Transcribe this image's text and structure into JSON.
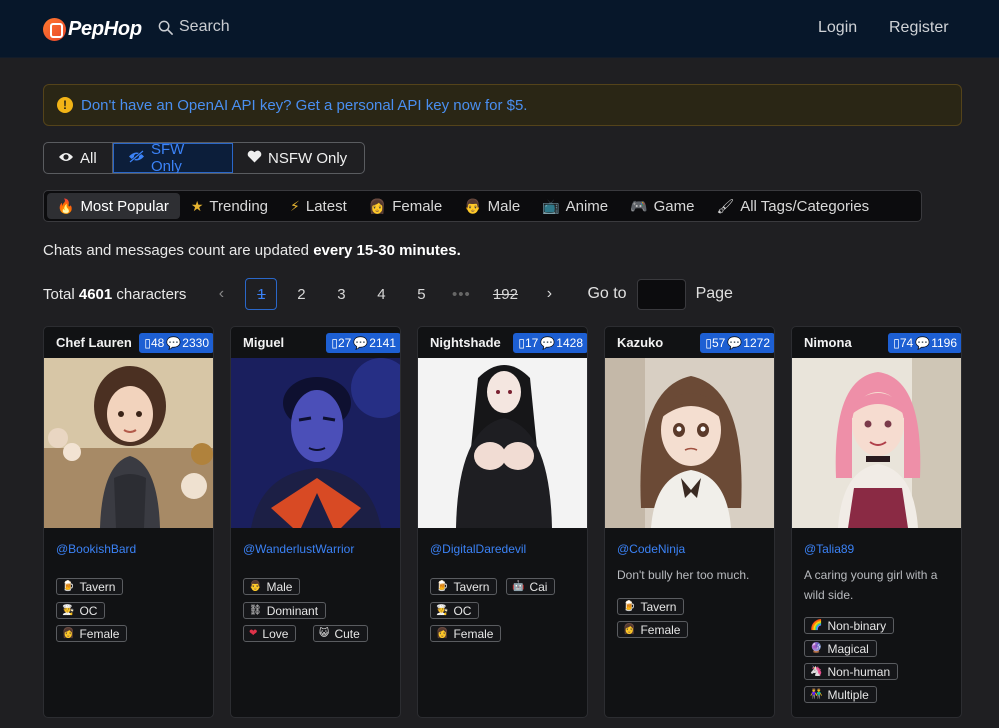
{
  "brand": {
    "name": "PepHop"
  },
  "nav": {
    "search_label": "Search",
    "login": "Login",
    "register": "Register"
  },
  "alert": {
    "text": "Don't have an OpenAI API key? Get a personal API key now for $5."
  },
  "filters": [
    {
      "label": "All",
      "icon": "eye-icon"
    },
    {
      "label": "SFW Only",
      "icon": "eye-slash-icon",
      "active": true
    },
    {
      "label": "NSFW Only",
      "icon": "heart-icon"
    }
  ],
  "tabs": [
    {
      "label": "Most Popular",
      "icon": "fire-icon",
      "active": true
    },
    {
      "label": "Trending",
      "icon": "star-icon"
    },
    {
      "label": "Latest",
      "icon": "lightning-icon"
    },
    {
      "label": "Female",
      "icon": "woman-icon"
    },
    {
      "label": "Male",
      "icon": "man-icon"
    },
    {
      "label": "Anime",
      "icon": "tv-icon"
    },
    {
      "label": "Game",
      "icon": "gamepad-icon"
    },
    {
      "label": "All Tags/Categories",
      "icon": "brush-icon"
    }
  ],
  "notice": {
    "prefix": "Chats and messages count are updated ",
    "emphasis": "every 15-30 minutes."
  },
  "pager": {
    "total_prefix": "Total ",
    "total_count": "4601",
    "total_suffix": " characters",
    "pages": [
      "1",
      "2",
      "3",
      "4",
      "5",
      "•••",
      "192"
    ],
    "current": "1",
    "goto_label": "Go to",
    "page_label": "Page"
  },
  "cards": [
    {
      "name": "Chef Lauren",
      "chats": "48",
      "messages": "2330",
      "author": "@BookishBard",
      "description": "",
      "tags": [
        {
          "icon": "🍺",
          "label": "Tavern"
        },
        {
          "icon": "🧑‍🍳",
          "label": "OC"
        },
        {
          "icon": "👩",
          "label": "Female"
        }
      ]
    },
    {
      "name": "Miguel",
      "chats": "27",
      "messages": "2141",
      "author": "@WanderlustWarrior",
      "description": "",
      "tags": [
        {
          "icon": "👨",
          "label": "Male"
        },
        {
          "icon": "⛓",
          "label": "Dominant"
        },
        {
          "icon": "❤",
          "label": "Love"
        },
        {
          "icon": "😺",
          "label": "Cute"
        }
      ]
    },
    {
      "name": "Nightshade",
      "chats": "17",
      "messages": "1428",
      "author": "@DigitalDaredevil",
      "description": "",
      "tags": [
        {
          "icon": "🍺",
          "label": "Tavern"
        },
        {
          "icon": "🤖",
          "label": "Cai"
        },
        {
          "icon": "🧑‍🍳",
          "label": "OC"
        },
        {
          "icon": "👩",
          "label": "Female"
        }
      ]
    },
    {
      "name": "Kazuko",
      "chats": "57",
      "messages": "1272",
      "author": "@CodeNinja",
      "description": "Don't bully her too much.",
      "tags": [
        {
          "icon": "🍺",
          "label": "Tavern"
        },
        {
          "icon": "👩",
          "label": "Female"
        }
      ]
    },
    {
      "name": "Nimona",
      "chats": "74",
      "messages": "1196",
      "author": "@Talia89",
      "description": "A caring young girl with a wild side.",
      "tags": [
        {
          "icon": "🌈",
          "label": "Non-binary"
        },
        {
          "icon": "🔮",
          "label": "Magical"
        },
        {
          "icon": "🦄",
          "label": "Non-human"
        },
        {
          "icon": "👫",
          "label": "Multiple"
        }
      ]
    }
  ]
}
